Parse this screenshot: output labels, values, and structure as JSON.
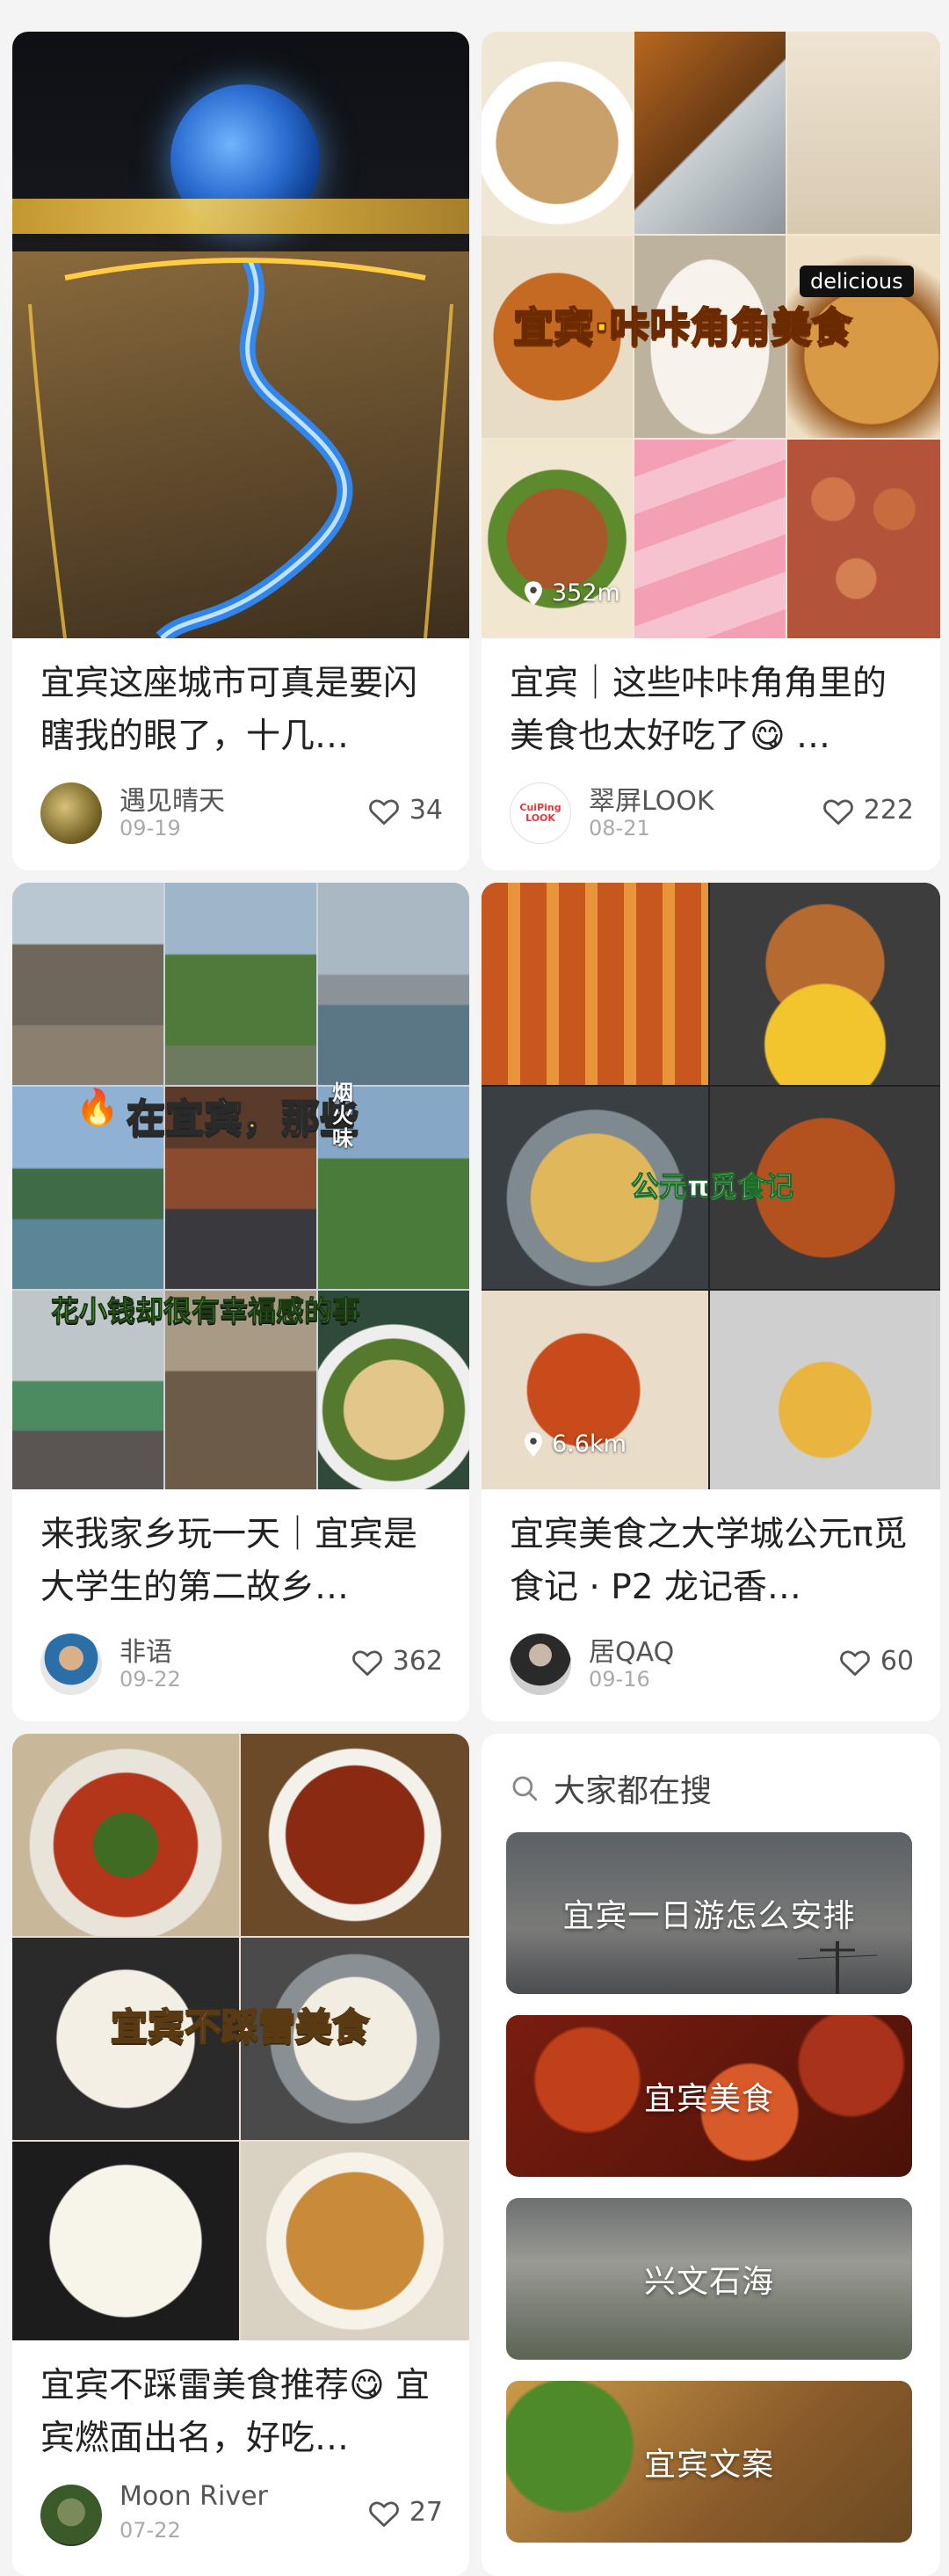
{
  "feed": {
    "cards": [
      {
        "title": "宜宾这座城市可真是要闪瞎我的眼了，十几…",
        "author": "遇见晴天",
        "date": "09-19",
        "likes": "34",
        "image_desc": "night-city-globe"
      },
      {
        "title": "宜宾｜这些咔咔角角里的美食也太好吃了😋 …",
        "author": "翠屏LOOK",
        "date": "08-21",
        "likes": "222",
        "overlay": "宜宾·咔咔角角美食",
        "tag": "delicious",
        "location": "352m",
        "avatar_text": "CuiPing LOOK"
      },
      {
        "title": "来我家乡玩一天｜宜宾是大学生的第二故乡…",
        "author": "非语",
        "date": "09-22",
        "likes": "362",
        "overlay_top": "在宜宾，那些",
        "overlay_side": "烟火味",
        "overlay_bottom": "花小钱却很有幸福感的事"
      },
      {
        "title": "宜宾美食之大学城公元π觅食记 · P2 龙记香…",
        "author": "居QAQ",
        "date": "09-16",
        "likes": "60",
        "overlay": "公元π觅食记",
        "location": "6.6km"
      },
      {
        "title": "宜宾不踩雷美食推荐😋 宜宾燃面出名，好吃…",
        "author": "Moon River",
        "date": "07-22",
        "likes": "27",
        "overlay": "宜宾不踩雷美食"
      }
    ]
  },
  "search": {
    "heading": "大家都在搜",
    "items": [
      "宜宾一日游怎么安排",
      "宜宾美食",
      "兴文石海",
      "宜宾文案"
    ]
  },
  "icons": {
    "heart": "heart-outline-icon",
    "location": "location-pin-icon",
    "search": "search-icon"
  },
  "colors": {
    "accent_yellow": "#ffd400",
    "overlay_green": "#9be36a",
    "card_bg": "#ffffff",
    "page_bg": "#f4f4f4"
  }
}
